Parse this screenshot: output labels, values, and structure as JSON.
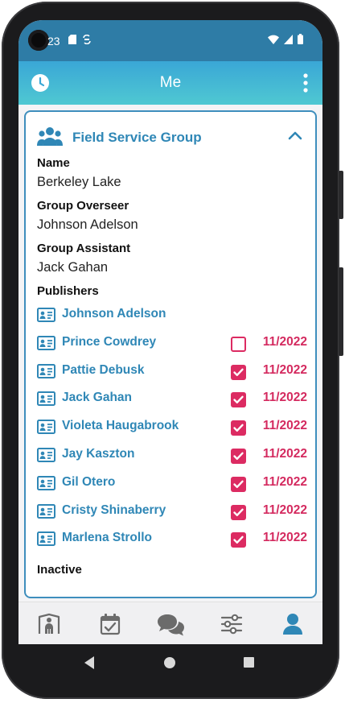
{
  "status_bar": {
    "time": "23"
  },
  "app_bar": {
    "title": "Me"
  },
  "card": {
    "title": "Field Service Group",
    "name_label": "Name",
    "name_value": "Berkeley Lake",
    "overseer_label": "Group Overseer",
    "overseer_value": "Johnson Adelson",
    "assistant_label": "Group Assistant",
    "assistant_value": "Jack Gahan",
    "publishers_label": "Publishers",
    "publishers": [
      {
        "name": "Johnson Adelson",
        "has_report": false,
        "date": ""
      },
      {
        "name": "Prince Cowdrey",
        "has_report": true,
        "checked": false,
        "date": "11/2022"
      },
      {
        "name": "Pattie Debusk",
        "has_report": true,
        "checked": true,
        "date": "11/2022"
      },
      {
        "name": "Jack Gahan",
        "has_report": true,
        "checked": true,
        "date": "11/2022"
      },
      {
        "name": "Violeta Haugabrook",
        "has_report": true,
        "checked": true,
        "date": "11/2022"
      },
      {
        "name": "Jay Kaszton",
        "has_report": true,
        "checked": true,
        "date": "11/2022"
      },
      {
        "name": "Gil Otero",
        "has_report": true,
        "checked": true,
        "date": "11/2022"
      },
      {
        "name": "Cristy Shinaberry",
        "has_report": true,
        "checked": true,
        "date": "11/2022"
      },
      {
        "name": "Marlena Strollo",
        "has_report": true,
        "checked": true,
        "date": "11/2022"
      }
    ],
    "inactive_label": "Inactive"
  },
  "bottom_nav": [
    {
      "icon": "person-in-door-icon",
      "active": false
    },
    {
      "icon": "calendar-check-icon",
      "active": false
    },
    {
      "icon": "chat-bubbles-icon",
      "active": false
    },
    {
      "icon": "sliders-icon",
      "active": false
    },
    {
      "icon": "user-icon",
      "active": true
    }
  ],
  "colors": {
    "primary": "#2f87b6",
    "accent": "#dc2b62",
    "status_bar": "#2e7ca6",
    "app_bar_top": "#3aa7d6",
    "app_bar_bottom": "#4fc8d2",
    "nav_inactive": "#6b6b6b",
    "nav_active": "#2f87b6"
  }
}
